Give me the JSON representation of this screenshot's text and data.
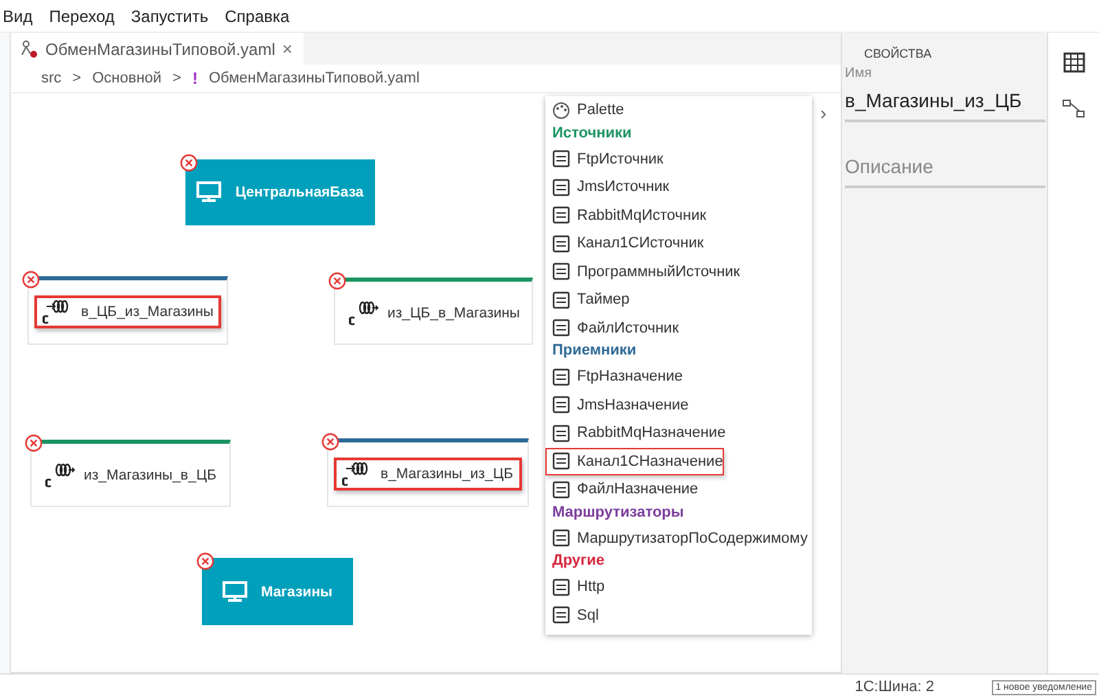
{
  "menu": [
    "Вид",
    "Переход",
    "Запустить",
    "Справка"
  ],
  "tab": {
    "title": "ОбменМагазиныТиповой.yaml",
    "close": "×"
  },
  "breadcrumb": {
    "items": [
      "src",
      "Основной"
    ],
    "separator": ">",
    "marker": "!",
    "file": "ОбменМагазиныТиповой.yaml"
  },
  "canvas": {
    "expand": "›",
    "nodes": [
      {
        "kind": "system",
        "label": "ЦентральнаяБаза"
      },
      {
        "kind": "target",
        "label": "в_ЦБ_из_Магазины",
        "color": "#2e6a96",
        "highlighted": true
      },
      {
        "kind": "source",
        "label": "из_ЦБ_в_Магазины",
        "color": "#1a9460",
        "highlighted": false
      },
      {
        "kind": "source",
        "label": "из_Магазины_в_ЦБ",
        "color": "#1a9460",
        "highlighted": false
      },
      {
        "kind": "target",
        "label": "в_Магазины_из_ЦБ",
        "color": "#2e6a96",
        "highlighted": true
      },
      {
        "kind": "system",
        "label": "Магазины"
      }
    ]
  },
  "palette": {
    "title": "Palette",
    "groups": [
      {
        "title": "Источники",
        "color": "#1a9460",
        "items": [
          {
            "label": "FtpИсточник",
            "highlighted": false
          },
          {
            "label": "JmsИсточник",
            "highlighted": false
          },
          {
            "label": "RabbitMqИсточник",
            "highlighted": false
          },
          {
            "label": "Канал1СИсточник",
            "highlighted": false
          },
          {
            "label": "ПрограммныйИсточник",
            "highlighted": false
          },
          {
            "label": "Таймер",
            "highlighted": false
          },
          {
            "label": "ФайлИсточник",
            "highlighted": false
          }
        ]
      },
      {
        "title": "Приемники",
        "color": "#2e6a96",
        "items": [
          {
            "label": "FtpНазначение",
            "highlighted": false
          },
          {
            "label": "JmsНазначение",
            "highlighted": false
          },
          {
            "label": "RabbitMqНазначение",
            "highlighted": false
          },
          {
            "label": "Канал1СНазначение",
            "highlighted": true
          },
          {
            "label": "ФайлНазначение",
            "highlighted": false
          }
        ]
      },
      {
        "title": "Маршрутизаторы",
        "color": "#7b3d9c",
        "items": [
          {
            "label": "МаршрутизаторПоСодержимому",
            "highlighted": false
          }
        ]
      },
      {
        "title": "Другие",
        "color": "#d7263d",
        "items": [
          {
            "label": "Http",
            "highlighted": false
          },
          {
            "label": "Sql",
            "highlighted": false
          }
        ]
      }
    ]
  },
  "properties": {
    "title": "СВОЙСТВА",
    "fields": [
      {
        "label": "Имя",
        "value": "в_Магазины_из_ЦБ"
      },
      {
        "placeholder": "Описание"
      }
    ]
  },
  "status_bar": {
    "text": "1С:Шина: 2",
    "tooltip": "1 новое уведомление"
  }
}
